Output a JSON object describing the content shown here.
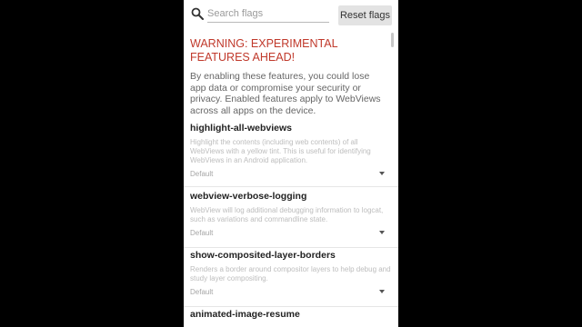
{
  "search": {
    "placeholder": "Search flags",
    "reset_label": "Reset flags"
  },
  "warning": {
    "title": "WARNING: EXPERIMENTAL FEATURES AHEAD!",
    "body": "By enabling these features, you could lose app data or compromise your security or privacy. Enabled features apply to WebViews across all apps on the device."
  },
  "flags": [
    {
      "name": "highlight-all-webviews",
      "description": "Highlight the contents (including web contents) of all WebViews with a yellow tint. This is useful for identifying WebViews in an Android application.",
      "value": "Default"
    },
    {
      "name": "webview-verbose-logging",
      "description": "WebView will log additional debugging information to logcat, such as variations and commandline state.",
      "value": "Default"
    },
    {
      "name": "show-composited-layer-borders",
      "description": "Renders a border around compositor layers to help debug and study layer compositing.",
      "value": "Default"
    },
    {
      "name": "animated-image-resume",
      "description": "",
      "value": ""
    }
  ],
  "icons": {
    "search": "search-icon",
    "dropdown": "chevron-down-icon"
  },
  "colors": {
    "warning_title": "#c0392b",
    "reset_button_bg": "#e3e3e3"
  }
}
